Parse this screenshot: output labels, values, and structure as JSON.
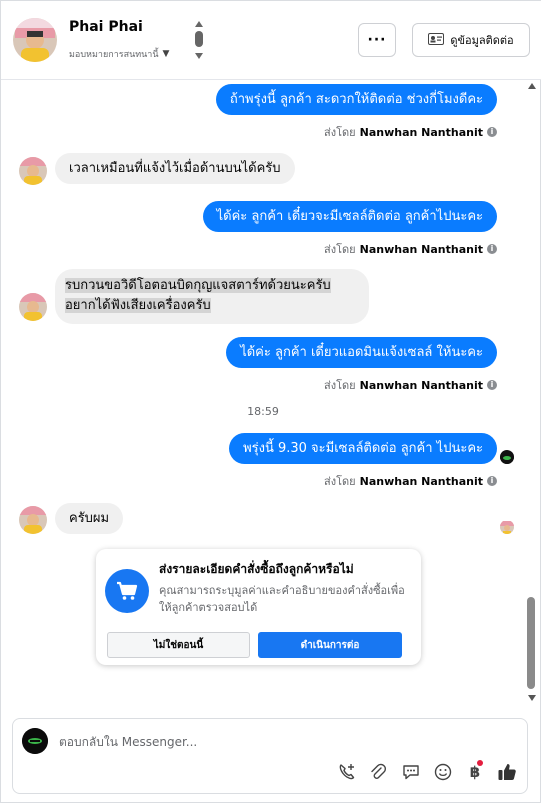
{
  "header": {
    "contact_name": "Phai Phai",
    "assign_label": "มอบหมายการสนทนานี้",
    "more_label": "···",
    "contact_info_label": "ดูข้อมูลติดต่อ"
  },
  "messages": [
    {
      "dir": "out",
      "text": "ถ้าพรุ่งนี้ ลูกค้า สะดวกให้ติดต่อ ช่วงกี่โมงดีคะ",
      "sent_by_prefix": "ส่งโดย",
      "sent_by_name": "Nanwhan Nanthanit"
    },
    {
      "dir": "in",
      "text": "เวลาเหมือนที่แจ้งไว้เมื่อด้านบนได้ครับ"
    },
    {
      "dir": "out",
      "text": "ได้ค่ะ  ลูกค้า เดี๋ยวจะมีเซลล์ติดต่อ ลูกค้าไปนะคะ",
      "sent_by_prefix": "ส่งโดย",
      "sent_by_name": "Nanwhan Nanthanit"
    },
    {
      "dir": "in",
      "line1": "รบกวนขอวิดีโอตอนบิดกุญแจสตาร์ทด้วยนะครับ",
      "line2": "อยากได้ฟังเสียงเครื่องครับ"
    },
    {
      "dir": "out",
      "text": "ได้ค่ะ  ลูกค้า เดี๋ยวแอดมินแจ้งเซลล์ ให้นะคะ",
      "sent_by_prefix": "ส่งโดย",
      "sent_by_name": "Nanwhan Nanthanit"
    },
    {
      "dir": "time",
      "text": "18:59"
    },
    {
      "dir": "out",
      "text": "พรุ่งนี้ 9.30 จะมีเซลล์ติดต่อ ลูกค้า ไปนะคะ",
      "sent_by_prefix": "ส่งโดย",
      "sent_by_name": "Nanwhan Nanthanit"
    },
    {
      "dir": "in",
      "text": "ครับผม"
    }
  ],
  "order_card": {
    "title": "ส่งรายละเอียดคำสั่งซื้อถึงลูกค้าหรือไม่",
    "description": "คุณสามารถระบุมูลค่าและคำอธิบายของคำสั่งซื้อเพื่อให้ลูกค้าตรวจสอบได้",
    "not_now_label": "ไม่ใช่ตอนนี้",
    "continue_label": "ดำเนินการต่อ"
  },
  "composer": {
    "placeholder": "ตอบกลับใน Messenger...",
    "baht_symbol": "฿"
  },
  "colors": {
    "outgoing_bubble": "#0a7cff",
    "incoming_bubble": "#f0f0f0",
    "primary_button": "#1877f2",
    "notification_dot": "#e41e3f"
  },
  "icons": [
    "chevron-down-icon",
    "contact-card-icon",
    "info-icon",
    "cart-icon",
    "call-add-icon",
    "paperclip-icon",
    "chat-bubble-icon",
    "emoji-icon",
    "baht-icon",
    "thumbs-up-icon"
  ]
}
